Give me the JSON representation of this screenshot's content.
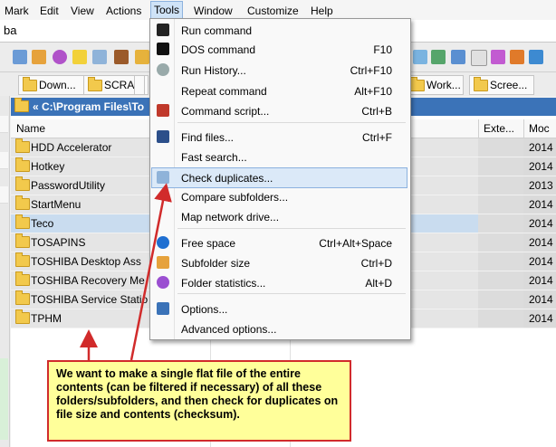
{
  "menubar": [
    "Mark",
    "Edit",
    "View",
    "Actions",
    "Tools",
    "Window",
    "Customize",
    "Help"
  ],
  "path_text": "ba",
  "file_tabs": [
    "Down...",
    "SCRA...",
    "",
    "Work...",
    "Scree..."
  ],
  "panel": {
    "path": "« C:\\Program Files\\To",
    "columns": {
      "name": "Name",
      "ext": "Exte...",
      "modified": "Moc"
    },
    "rows": [
      {
        "name": "HDD Accelerator",
        "modified": "2014"
      },
      {
        "name": "Hotkey",
        "modified": "2014"
      },
      {
        "name": "PasswordUtility",
        "modified": "2013"
      },
      {
        "name": "StartMenu",
        "modified": "2014"
      },
      {
        "name": "Teco",
        "modified": "2014",
        "selected": true
      },
      {
        "name": "TOSAPINS",
        "modified": "2014"
      },
      {
        "name": "TOSHIBA Desktop Ass",
        "modified": "2014"
      },
      {
        "name": "TOSHIBA Recovery Me",
        "modified": "2014"
      },
      {
        "name": "TOSHIBA Service Statio",
        "modified": "2014"
      },
      {
        "name": "TPHM",
        "modified": "2014"
      }
    ]
  },
  "tools_menu": {
    "items": [
      {
        "label": "Run command",
        "shortcut": "",
        "icon": "console-icon"
      },
      {
        "label": "DOS command",
        "shortcut": "F10",
        "icon": "dos-icon"
      },
      {
        "label": "Run History...",
        "shortcut": "Ctrl+F10",
        "icon": "clock-icon"
      },
      {
        "label": "Repeat command",
        "shortcut": "Alt+F10",
        "icon": ""
      },
      {
        "label": "Command script...",
        "shortcut": "Ctrl+B",
        "icon": "script-icon"
      },
      {
        "label": "Find files...",
        "shortcut": "Ctrl+F",
        "icon": "binoculars-icon"
      },
      {
        "label": "Fast search...",
        "shortcut": "",
        "icon": ""
      },
      {
        "label": "Check duplicates...",
        "shortcut": "",
        "icon": "duplicates-icon"
      },
      {
        "label": "Compare subfolders...",
        "shortcut": "",
        "icon": ""
      },
      {
        "label": "Map network drive...",
        "shortcut": "",
        "icon": ""
      },
      {
        "label": "Free space",
        "shortcut": "Ctrl+Alt+Space",
        "icon": "info-icon"
      },
      {
        "label": "Subfolder size",
        "shortcut": "Ctrl+D",
        "icon": "folder-size-icon"
      },
      {
        "label": "Folder statistics...",
        "shortcut": "Alt+D",
        "icon": "pie-chart-icon"
      },
      {
        "label": "Options...",
        "shortcut": "",
        "icon": "options-icon"
      },
      {
        "label": "Advanced options...",
        "shortcut": "",
        "icon": ""
      }
    ]
  },
  "annotation": {
    "text": "We want to make a single flat file of the entire contents (can be filtered if necessary) of all these folders/subfolders, and then check for duplicates on file size and contents (checksum).",
    "border_color": "#d12b2b",
    "background": "#ffff9a"
  },
  "colors": {
    "accent": "#3b73b8",
    "highlight": "#dbe9f8",
    "arrow": "#d12b2b"
  }
}
